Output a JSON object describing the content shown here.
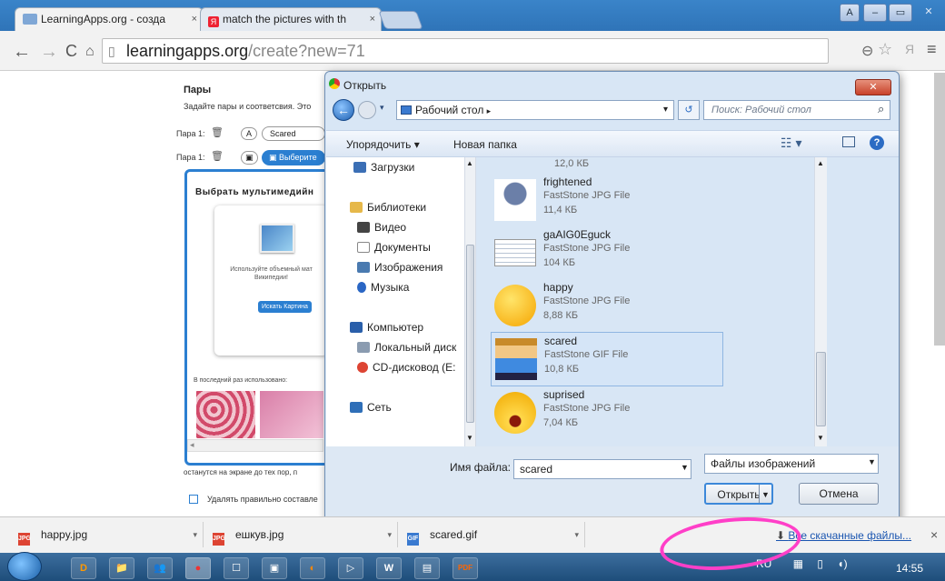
{
  "browser": {
    "tabs": [
      {
        "label": "LearningApps.org - созда",
        "close": "×"
      },
      {
        "label": "match the pictures with th",
        "close": "×"
      }
    ],
    "window_buttons": [
      "A",
      "–",
      "▭",
      "✕"
    ],
    "url_host": "learningapps.org",
    "url_path": "/create?new=71"
  },
  "page": {
    "section_title": "Пары",
    "instructions": "Задайте пары и соответсвия. Это",
    "pair1_label": "Пара 1:",
    "pair1_text": "Scared",
    "pair2_label": "Пара 1:",
    "pair2_button": "Выберите",
    "media_title": "Выбрать мультимедийн",
    "media_hint": "Используйте объемный мат Википедии!",
    "search_image_button": "Искать Картина",
    "recent_label": "В последний раз использовано:",
    "bottom_text": "останутся на экране до тех пор, п",
    "checkbox_label": "Удалять правильно составле"
  },
  "dialog": {
    "title": "Открыть",
    "location": "Рабочий стол",
    "search_placeholder": "Поиск: Рабочий стол",
    "organize": "Упорядочить ▾",
    "new_folder": "Новая папка",
    "nav": [
      {
        "label": "Загрузки",
        "icon": "downloads-icon"
      },
      {
        "label": "Библиотеки",
        "icon": "libraries-icon"
      },
      {
        "label": "Видео",
        "icon": "video-icon"
      },
      {
        "label": "Документы",
        "icon": "documents-icon"
      },
      {
        "label": "Изображения",
        "icon": "pictures-icon"
      },
      {
        "label": "Музыка",
        "icon": "music-icon"
      },
      {
        "label": "Компьютер",
        "icon": "computer-icon"
      },
      {
        "label": "Локальный диск",
        "icon": "local-disk-icon"
      },
      {
        "label": "CD-дисковод (E:",
        "icon": "cd-drive-icon"
      },
      {
        "label": "Сеть",
        "icon": "network-icon"
      }
    ],
    "partial_top_size": "12,0 КБ",
    "files": [
      {
        "name": "frightened",
        "type": "FastStone JPG File",
        "size": "11,4 КБ"
      },
      {
        "name": "gaAIG0Eguck",
        "type": "FastStone JPG File",
        "size": "104 КБ"
      },
      {
        "name": "happy",
        "type": "FastStone JPG File",
        "size": "8,88 КБ"
      },
      {
        "name": "scared",
        "type": "FastStone GIF File",
        "size": "10,8 КБ"
      },
      {
        "name": "suprised",
        "type": "FastStone JPG File",
        "size": "7,04 КБ"
      }
    ],
    "filename_label": "Имя файла:",
    "filename_value": "scared",
    "filter": "Файлы изображений",
    "open_button": "Открыть",
    "cancel_button": "Отмена"
  },
  "downloads": {
    "items": [
      {
        "name": "happy.jpg",
        "badge": "JPG"
      },
      {
        "name": "ешкув.jpg",
        "badge": "JPG"
      },
      {
        "name": "scared.gif",
        "badge": "GIF"
      }
    ],
    "show_all": "Все скачанные файлы...",
    "close": "×"
  },
  "taskbar": {
    "language": "RU",
    "time": "14:55",
    "apps": [
      "D",
      "📁",
      "👥",
      "●",
      "☐",
      "▣",
      "◐",
      "▷",
      "W",
      "▤",
      "PDF"
    ]
  },
  "colors": {
    "accent": "#2b7fd1",
    "highlight_ellipse": "#ff3fc8"
  }
}
